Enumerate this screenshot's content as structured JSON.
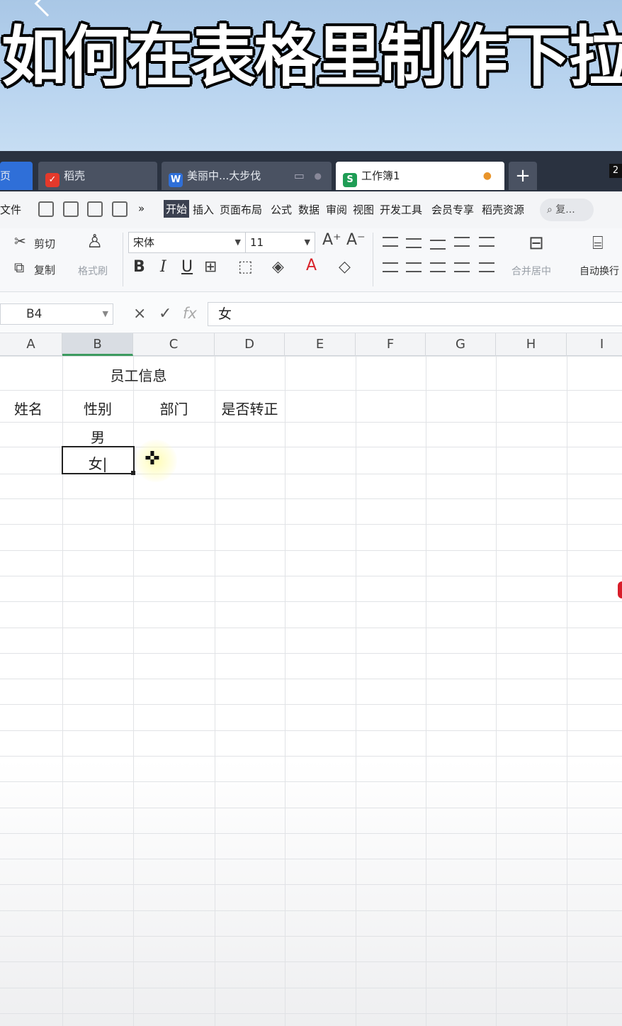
{
  "banner": {
    "title": "如何在表格里制作下拉菜"
  },
  "tabs": {
    "home": "页",
    "docer": "稻壳",
    "doc": "美丽中...大步伐",
    "workbook": "工作簿1",
    "add": "+",
    "corner": "2"
  },
  "menu": {
    "file": "文件",
    "more": "»",
    "items": [
      "开始",
      "插入",
      "页面布局",
      "公式",
      "数据",
      "审阅",
      "视图",
      "开发工具",
      "会员专享",
      "稻壳资源"
    ],
    "search_placeholder": "复..."
  },
  "ribbon": {
    "cut": "剪切",
    "copy": "复制",
    "format_painter": "格式刷",
    "font_name": "宋体",
    "font_size": "11",
    "bold": "B",
    "italic": "I",
    "underline": "U",
    "merge": "合并居中",
    "wrap": "自动换行"
  },
  "formula_bar": {
    "cell_ref": "B4",
    "cancel": "×",
    "confirm": "✓",
    "fx": "fx",
    "content": "女"
  },
  "sheet": {
    "columns": [
      "A",
      "B",
      "C",
      "D",
      "E",
      "F",
      "G",
      "H",
      "I"
    ],
    "title": "员工信息",
    "headers": [
      "姓名",
      "性别",
      "部门",
      "是否转正"
    ],
    "b3": "男",
    "b4_editing": "女|"
  }
}
